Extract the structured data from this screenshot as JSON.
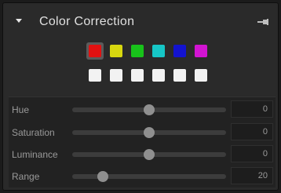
{
  "panel": {
    "title": "Color Correction",
    "collapse_icon": "triangle-down-icon",
    "pin_icon": "pin-icon"
  },
  "swatches": {
    "colors": [
      {
        "name": "red",
        "hex": "#e21111",
        "selected": true
      },
      {
        "name": "yellow",
        "hex": "#d7d70f",
        "selected": false
      },
      {
        "name": "green",
        "hex": "#18c21a",
        "selected": false
      },
      {
        "name": "cyan",
        "hex": "#16c6c6",
        "selected": false
      },
      {
        "name": "blue",
        "hex": "#1313cf",
        "selected": false
      },
      {
        "name": "magenta",
        "hex": "#d214d2",
        "selected": false
      }
    ],
    "neutral_count": 6,
    "neutral_hex": "#f2f2f2"
  },
  "adjustments": [
    {
      "key": "hue",
      "label": "Hue",
      "value": "0",
      "fraction": 0.5
    },
    {
      "key": "saturation",
      "label": "Saturation",
      "value": "0",
      "fraction": 0.5
    },
    {
      "key": "luminance",
      "label": "Luminance",
      "value": "0",
      "fraction": 0.5
    },
    {
      "key": "range",
      "label": "Range",
      "value": "20",
      "fraction": 0.2
    }
  ]
}
